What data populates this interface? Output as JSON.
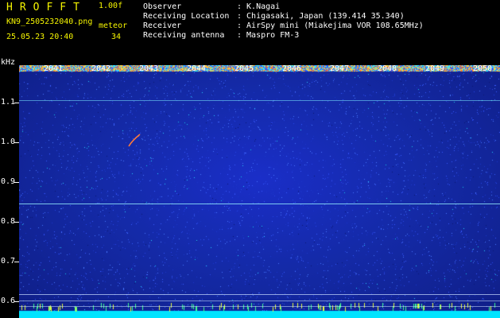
{
  "header": {
    "app_title": "HROFFT",
    "version": "1.00f",
    "filename": "KN9_2505232040.png",
    "mode": "meteor",
    "datetime": "25.05.23 20:40",
    "count": "34",
    "info": [
      {
        "label": "Observer",
        "value": ": K.Nagai"
      },
      {
        "label": "Receiving Location",
        "value": ": Chigasaki, Japan (139.414 35.340)"
      },
      {
        "label": "Receiver",
        "value": ": AirSpy mini (Miakejima VOR 108.65MHz)"
      },
      {
        "label": "Receiving antenna",
        "value": ": Maspro FM-3"
      }
    ]
  },
  "spectrogram": {
    "unit": "kHz",
    "y_ticks": [
      "1.1",
      "1.0",
      "0.9",
      "0.8",
      "0.7",
      "0.6"
    ],
    "x_ticks": [
      "2041",
      "2042",
      "2043",
      "2044",
      "2045",
      "2046",
      "2047",
      "2048",
      "2049",
      "2050"
    ],
    "colors": {
      "text": "#ffffff",
      "accent": "#f5f500",
      "bg": "#142aa8",
      "signal": "#00e8ff"
    }
  }
}
